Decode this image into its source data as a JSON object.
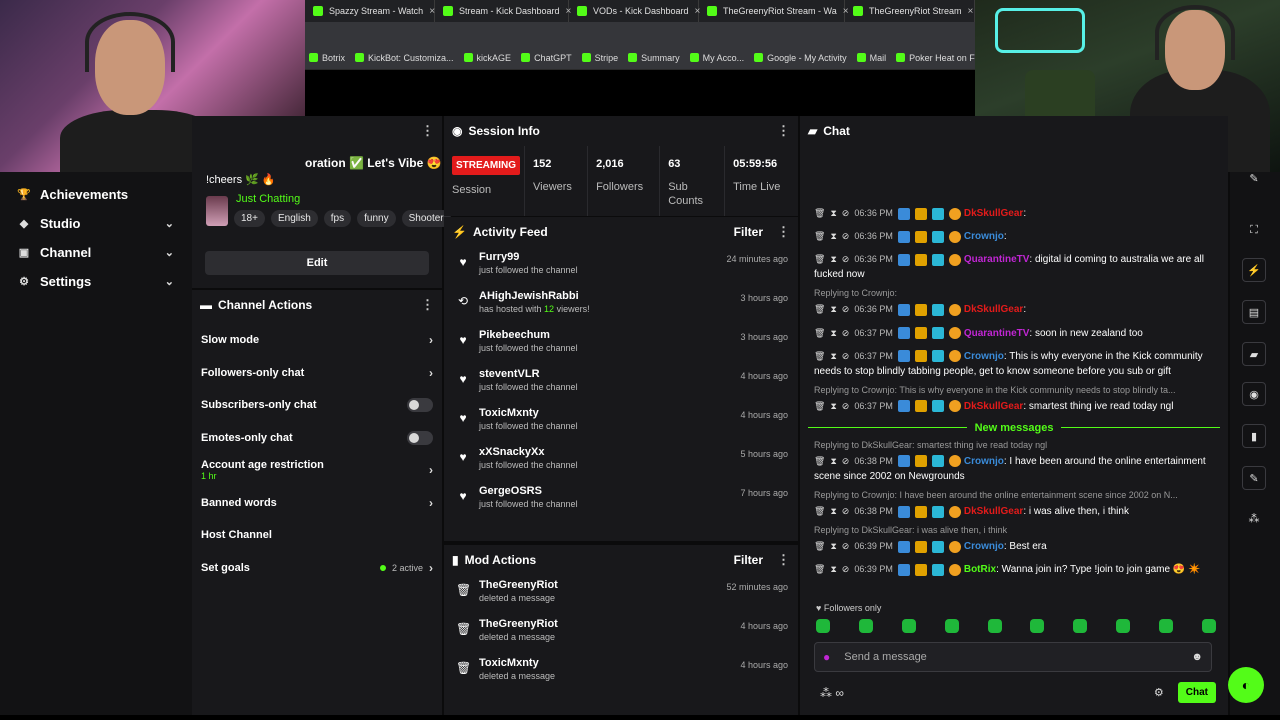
{
  "browser": {
    "tabs": [
      {
        "label": "Spazzy Stream - Watch"
      },
      {
        "label": "Stream - Kick Dashboard"
      },
      {
        "label": "VODs - Kick Dashboard"
      },
      {
        "label": "TheGreenyRiot Stream - Wa"
      },
      {
        "label": "TheGreenyRiot Stream"
      }
    ],
    "bookmarks": [
      "Botrix",
      "KickBot: Customiza...",
      "kickAGE",
      "ChatGPT",
      "Stripe",
      "Summary",
      "My Acco...",
      "Google - My Activity",
      "Mail",
      "Poker Heat on Face..."
    ]
  },
  "nav": {
    "items": [
      {
        "label": "Achievements",
        "icon": "trophy-icon",
        "has_chevron": false
      },
      {
        "label": "Studio",
        "icon": "studio-icon",
        "has_chevron": true
      },
      {
        "label": "Channel",
        "icon": "channel-icon",
        "has_chevron": true
      },
      {
        "label": "Settings",
        "icon": "gear-icon",
        "has_chevron": true
      }
    ]
  },
  "stream_info": {
    "title_fragment": "oration ✅ Let's Vibe 😍",
    "cheers_line": "!cheers 🌿 🔥",
    "category": "Just Chatting",
    "tags": [
      "18+",
      "English",
      "fps",
      "funny",
      "Shooter"
    ],
    "edit_label": "Edit"
  },
  "channel_actions": {
    "title": "Channel Actions",
    "rows": [
      {
        "label": "Slow mode",
        "control": "chevron"
      },
      {
        "label": "Followers-only chat",
        "control": "chevron"
      },
      {
        "label": "Subscribers-only chat",
        "control": "toggle"
      },
      {
        "label": "Emotes-only chat",
        "control": "toggle"
      },
      {
        "label": "Account age restriction",
        "sub": "1 hr",
        "control": "chevron"
      },
      {
        "label": "Banned words",
        "control": "chevron"
      },
      {
        "label": "Host Channel",
        "control": "none"
      },
      {
        "label": "Set goals",
        "control": "goals",
        "goals_text": "2 active"
      }
    ]
  },
  "session": {
    "title": "Session Info",
    "status": "STREAMING",
    "status_label": "Session",
    "stats": [
      {
        "value": "152",
        "label": "Viewers"
      },
      {
        "value": "2,016",
        "label": "Followers"
      },
      {
        "value": "63",
        "label": "Sub Counts"
      },
      {
        "value": "05:59:56",
        "label": "Time Live"
      }
    ]
  },
  "activity": {
    "title": "Activity Feed",
    "filter": "Filter",
    "items": [
      {
        "name": "Furry99",
        "desc": "just followed the channel",
        "time": "24 minutes ago",
        "icon": "heart-icon"
      },
      {
        "name": "AHighJewishRabbi",
        "desc_pre": "has hosted with ",
        "desc_hl": "12",
        "desc_post": " viewers!",
        "time": "3 hours ago",
        "icon": "host-icon"
      },
      {
        "name": "Pikebeechum",
        "desc": "just followed the channel",
        "time": "3 hours ago",
        "icon": "heart-icon"
      },
      {
        "name": "steventVLR",
        "desc": "just followed the channel",
        "time": "4 hours ago",
        "icon": "heart-icon"
      },
      {
        "name": "ToxicMxnty",
        "desc": "just followed the channel",
        "time": "4 hours ago",
        "icon": "heart-icon"
      },
      {
        "name": "xXSnackyXx",
        "desc": "just followed the channel",
        "time": "5 hours ago",
        "icon": "heart-icon"
      },
      {
        "name": "GergeOSRS",
        "desc": "just followed the channel",
        "time": "7 hours ago",
        "icon": "heart-icon"
      }
    ]
  },
  "mod_actions": {
    "title": "Mod Actions",
    "filter": "Filter",
    "items": [
      {
        "name": "TheGreenyRiot",
        "desc": "deleted a message",
        "time": "52 minutes ago"
      },
      {
        "name": "TheGreenyRiot",
        "desc": "deleted a message",
        "time": "4 hours ago"
      },
      {
        "name": "ToxicMxnty",
        "desc": "deleted a message",
        "time": "4 hours ago"
      }
    ]
  },
  "chat": {
    "title": "Chat",
    "messages": [
      {
        "type": "msg",
        "time": "06:36 PM",
        "user": "DkSkullGear",
        "color": "#e31b1b",
        "text": ""
      },
      {
        "type": "msg",
        "time": "06:36 PM",
        "user": "Crownjo",
        "color": "#3a8bd9",
        "text": ""
      },
      {
        "type": "msg",
        "time": "06:36 PM",
        "user": "QuarantineTV",
        "color": "#c026d3",
        "text": "digital id coming to australia we are all fucked now"
      },
      {
        "type": "reply",
        "text": "Replying to Crownjo:"
      },
      {
        "type": "msg",
        "time": "06:36 PM",
        "user": "DkSkullGear",
        "color": "#e31b1b",
        "text": ""
      },
      {
        "type": "msg",
        "time": "06:37 PM",
        "user": "QuarantineTV",
        "color": "#c026d3",
        "text": "soon in new zealand too"
      },
      {
        "type": "msg",
        "time": "06:37 PM",
        "user": "Crownjo",
        "color": "#3a8bd9",
        "text": "This is why everyone in the Kick community needs to stop blindly tabbing people, get to know someone before you sub or gift"
      },
      {
        "type": "reply",
        "text": "Replying to Crownjo: This is why everyone in the Kick community needs to stop blindly ta..."
      },
      {
        "type": "msg",
        "time": "06:37 PM",
        "user": "DkSkullGear",
        "color": "#e31b1b",
        "text": "smartest thing ive read today ngl"
      },
      {
        "type": "divider",
        "text": "New messages"
      },
      {
        "type": "reply",
        "text": "Replying to DkSkullGear: smartest thing ive read today ngl"
      },
      {
        "type": "msg",
        "time": "06:38 PM",
        "user": "Crownjo",
        "color": "#3a8bd9",
        "text": "I have been around the online entertainment scene since 2002 on Newgrounds"
      },
      {
        "type": "reply",
        "text": "Replying to Crownjo: I have been around the online entertainment scene since 2002 on N..."
      },
      {
        "type": "msg",
        "time": "06:38 PM",
        "user": "DkSkullGear",
        "color": "#e31b1b",
        "text": "i was alive then, i think"
      },
      {
        "type": "reply",
        "text": "Replying to DkSkullGear: i was alive then, i think"
      },
      {
        "type": "msg",
        "time": "06:39 PM",
        "user": "Crownjo",
        "color": "#3a8bd9",
        "text": "Best era"
      },
      {
        "type": "msg",
        "time": "06:39 PM",
        "user": "BotRix",
        "color": "#53fc18",
        "text": "Wanna join in? Type !join to join game 😍 ✴️"
      }
    ],
    "followers_only": "Followers only",
    "input_placeholder": "Send a message",
    "send_label": "Chat"
  }
}
